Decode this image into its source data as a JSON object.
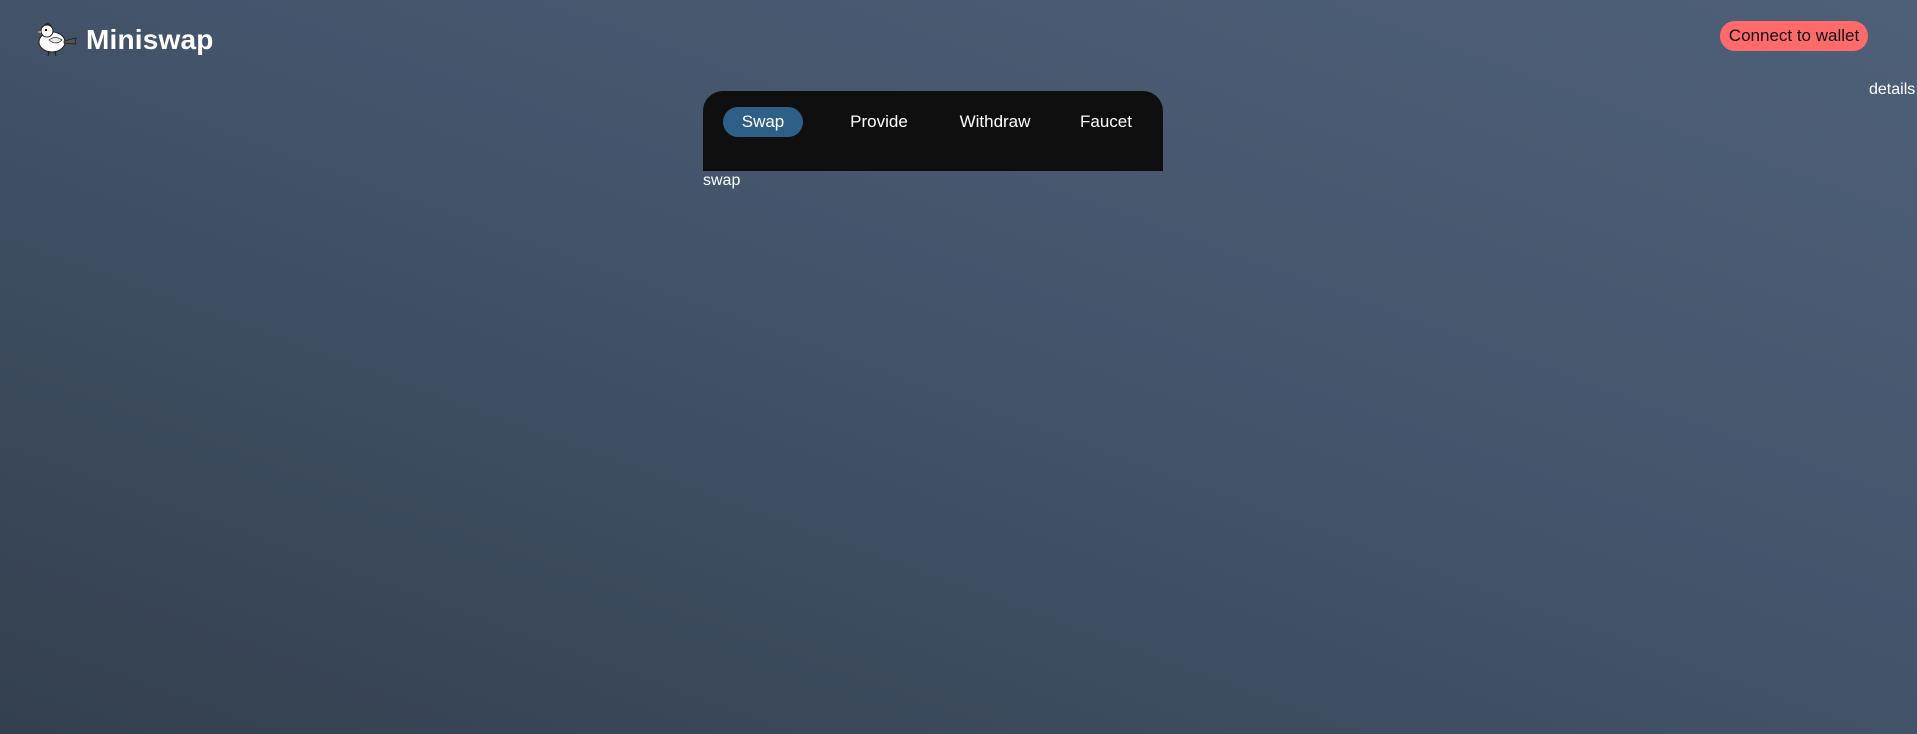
{
  "app": {
    "name": "Miniswap",
    "logo_icon": "bird-logo-icon"
  },
  "header": {
    "connect_label": "Connect to wallet",
    "connect_color": "#ff6b6b",
    "details_label": "details"
  },
  "tabs": [
    {
      "label": "Swap",
      "active": true
    },
    {
      "label": "Provide",
      "active": false
    },
    {
      "label": "Withdraw",
      "active": false
    },
    {
      "label": "Faucet",
      "active": false
    }
  ],
  "colors": {
    "active_tab": "#2e5f86",
    "panel": "#0f0f10"
  },
  "content": {
    "text": "swap"
  }
}
